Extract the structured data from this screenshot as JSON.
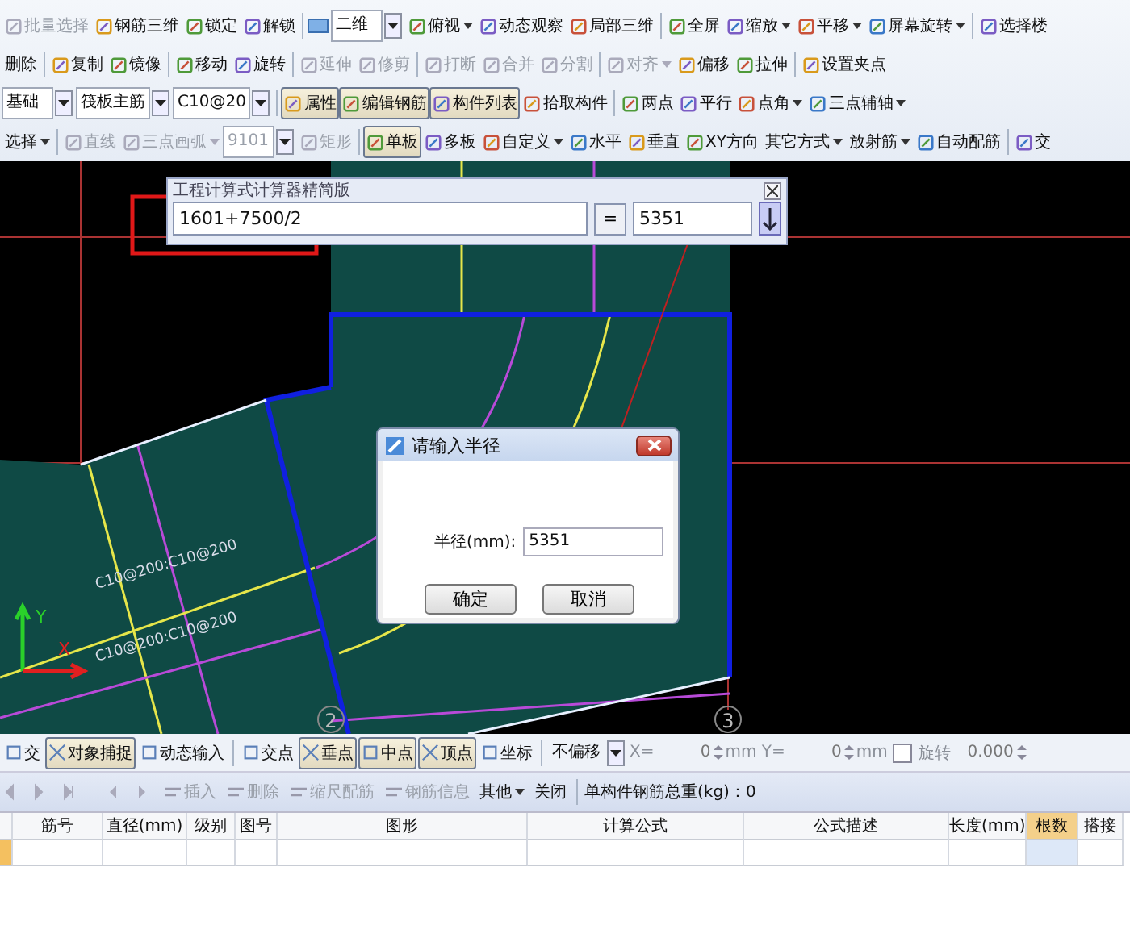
{
  "toolbars": [
    {
      "groups": [
        [
          {
            "kind": "tool",
            "label": "批量选择",
            "pressed": false,
            "disabled": true
          },
          {
            "kind": "tool",
            "label": "钢筋三维",
            "pressed": false,
            "disabled": false
          },
          {
            "kind": "tool",
            "label": "锁定",
            "pressed": false,
            "disabled": false
          },
          {
            "kind": "tool",
            "label": "解锁",
            "pressed": false,
            "disabled": false
          }
        ],
        [
          {
            "kind": "icon-combo",
            "label": "二维",
            "pressed": false,
            "disabled": false
          },
          {
            "kind": "tool-menu",
            "label": "俯视",
            "pressed": false,
            "disabled": false
          },
          {
            "kind": "tool",
            "label": "动态观察",
            "pressed": false,
            "disabled": false
          },
          {
            "kind": "tool",
            "label": "局部三维",
            "pressed": false,
            "disabled": false
          }
        ],
        [
          {
            "kind": "tool",
            "label": "全屏",
            "pressed": false,
            "disabled": false
          },
          {
            "kind": "tool-menu",
            "label": "缩放",
            "pressed": false,
            "disabled": false
          },
          {
            "kind": "tool-menu",
            "label": "平移",
            "pressed": false,
            "disabled": false
          },
          {
            "kind": "tool-menu",
            "label": "屏幕旋转",
            "pressed": false,
            "disabled": false
          }
        ],
        [
          {
            "kind": "tool",
            "label": "选择楼",
            "pressed": false,
            "disabled": false
          }
        ]
      ]
    },
    {
      "groups": [
        [
          {
            "kind": "text",
            "label": "删除",
            "pressed": false,
            "disabled": false
          }
        ],
        [
          {
            "kind": "tool",
            "label": "复制",
            "pressed": false,
            "disabled": false
          },
          {
            "kind": "tool",
            "label": "镜像",
            "pressed": false,
            "disabled": false
          }
        ],
        [
          {
            "kind": "tool",
            "label": "移动",
            "pressed": false,
            "disabled": false
          },
          {
            "kind": "tool",
            "label": "旋转",
            "pressed": false,
            "disabled": false
          }
        ],
        [
          {
            "kind": "tool",
            "label": "延伸",
            "pressed": false,
            "disabled": true
          },
          {
            "kind": "tool",
            "label": "修剪",
            "pressed": false,
            "disabled": true
          }
        ],
        [
          {
            "kind": "tool",
            "label": "打断",
            "pressed": false,
            "disabled": true
          },
          {
            "kind": "tool",
            "label": "合并",
            "pressed": false,
            "disabled": true
          },
          {
            "kind": "tool",
            "label": "分割",
            "pressed": false,
            "disabled": true
          }
        ],
        [
          {
            "kind": "tool-menu",
            "label": "对齐",
            "pressed": false,
            "disabled": true
          },
          {
            "kind": "tool",
            "label": "偏移",
            "pressed": false,
            "disabled": false
          },
          {
            "kind": "tool",
            "label": "拉伸",
            "pressed": false,
            "disabled": false
          }
        ],
        [
          {
            "kind": "tool",
            "label": "设置夹点",
            "pressed": false,
            "disabled": false
          }
        ]
      ]
    },
    {
      "groups": [
        [
          {
            "kind": "combo",
            "label": "基础",
            "pressed": false,
            "disabled": false
          },
          {
            "kind": "combo",
            "label": "筏板主筋",
            "pressed": false,
            "disabled": false
          },
          {
            "kind": "combo",
            "label": "C10@20",
            "pressed": false,
            "disabled": false
          }
        ],
        [
          {
            "kind": "tool",
            "label": "属性",
            "pressed": true,
            "disabled": false
          },
          {
            "kind": "tool",
            "label": "编辑钢筋",
            "pressed": true,
            "disabled": false
          },
          {
            "kind": "tool",
            "label": "构件列表",
            "pressed": true,
            "disabled": false
          },
          {
            "kind": "tool",
            "label": "拾取构件",
            "pressed": false,
            "disabled": false
          }
        ],
        [
          {
            "kind": "tool",
            "label": "两点",
            "pressed": false,
            "disabled": false
          },
          {
            "kind": "tool",
            "label": "平行",
            "pressed": false,
            "disabled": false
          },
          {
            "kind": "tool-menu",
            "label": "点角",
            "pressed": false,
            "disabled": false
          },
          {
            "kind": "tool-menu",
            "label": "三点辅轴",
            "pressed": false,
            "disabled": false
          }
        ]
      ]
    },
    {
      "groups": [
        [
          {
            "kind": "menu",
            "label": "选择",
            "pressed": false,
            "disabled": false
          }
        ],
        [
          {
            "kind": "tool",
            "label": "直线",
            "pressed": false,
            "disabled": true
          },
          {
            "kind": "tool-menu",
            "label": "三点画弧",
            "pressed": false,
            "disabled": true
          },
          {
            "kind": "combo",
            "label": "9101",
            "pressed": false,
            "disabled": true
          },
          {
            "kind": "tool",
            "label": "矩形",
            "pressed": false,
            "disabled": true
          }
        ],
        [
          {
            "kind": "tool",
            "label": "单板",
            "pressed": true,
            "disabled": false
          },
          {
            "kind": "tool",
            "label": "多板",
            "pressed": false,
            "disabled": false
          },
          {
            "kind": "tool-menu",
            "label": "自定义",
            "pressed": false,
            "disabled": false
          },
          {
            "kind": "tool",
            "label": "水平",
            "pressed": false,
            "disabled": false
          },
          {
            "kind": "tool",
            "label": "垂直",
            "pressed": false,
            "disabled": false
          },
          {
            "kind": "tool",
            "label": "XY方向",
            "pressed": false,
            "disabled": false
          },
          {
            "kind": "menu",
            "label": "其它方式",
            "pressed": false,
            "disabled": false
          },
          {
            "kind": "menu",
            "label": "放射筋",
            "pressed": false,
            "disabled": false
          },
          {
            "kind": "tool",
            "label": "自动配筋",
            "pressed": false,
            "disabled": false
          }
        ],
        [
          {
            "kind": "tool",
            "label": "交",
            "pressed": false,
            "disabled": false
          }
        ]
      ]
    }
  ],
  "canvas": {
    "axis_labels": [
      "2",
      "3"
    ],
    "rebar_labels": [
      "C10@200:C10@200",
      "C10@200:C10@200"
    ],
    "x_label": "X",
    "y_label": "Y"
  },
  "calculator": {
    "title": "工程计算式计算器精简版",
    "expression": "1601+7500/2",
    "equals": "=",
    "result": "5351"
  },
  "dialog": {
    "title": "请输入半径",
    "field_label": "半径(mm):",
    "value": "5351",
    "buttons": [
      "确定",
      "取消"
    ]
  },
  "snap_bar": [
    [
      {
        "kind": "button",
        "label": "交",
        "pressed": false
      },
      {
        "kind": "button",
        "label": "对象捕捉",
        "pressed": true
      },
      {
        "kind": "button",
        "label": "动态输入",
        "pressed": false
      }
    ],
    [
      {
        "kind": "button",
        "label": "交点",
        "pressed": false
      },
      {
        "kind": "button",
        "label": "垂点",
        "pressed": true
      },
      {
        "kind": "button",
        "label": "中点",
        "pressed": true
      },
      {
        "kind": "button",
        "label": "顶点",
        "pressed": true
      },
      {
        "kind": "button",
        "label": "坐标",
        "pressed": false
      }
    ],
    [
      {
        "kind": "combo",
        "label": "不偏移"
      },
      {
        "kind": "text",
        "label": "X="
      },
      {
        "kind": "spin",
        "label": "0"
      },
      {
        "kind": "text",
        "label": "mm Y="
      },
      {
        "kind": "spin",
        "label": "0"
      },
      {
        "kind": "text",
        "label": "mm"
      },
      {
        "kind": "check",
        "label": "旋转",
        "checked": false
      },
      {
        "kind": "spin",
        "label": "0.000"
      }
    ]
  ],
  "rebar_toolbar": {
    "buttons": [
      {
        "label": "插入",
        "disabled": true,
        "menu": false
      },
      {
        "label": "删除",
        "disabled": true,
        "menu": false
      },
      {
        "label": "缩尺配筋",
        "disabled": true,
        "menu": false
      },
      {
        "label": "钢筋信息",
        "disabled": true,
        "menu": false
      },
      {
        "label": "其他",
        "disabled": false,
        "menu": true
      },
      {
        "label": "关闭",
        "disabled": false,
        "menu": false
      }
    ],
    "total_weight": "单构件钢筋总重(kg)：0"
  },
  "table": {
    "columns": [
      {
        "label": "筋号",
        "selected": false
      },
      {
        "label": "直径(mm)",
        "selected": false
      },
      {
        "label": "级别",
        "selected": false
      },
      {
        "label": "图号",
        "selected": false
      },
      {
        "label": "图形",
        "selected": false
      },
      {
        "label": "计算公式",
        "selected": false
      },
      {
        "label": "公式描述",
        "selected": false
      },
      {
        "label": "长度(mm)",
        "selected": false
      },
      {
        "label": "根数",
        "selected": true
      },
      {
        "label": "搭接",
        "selected": false
      }
    ]
  }
}
